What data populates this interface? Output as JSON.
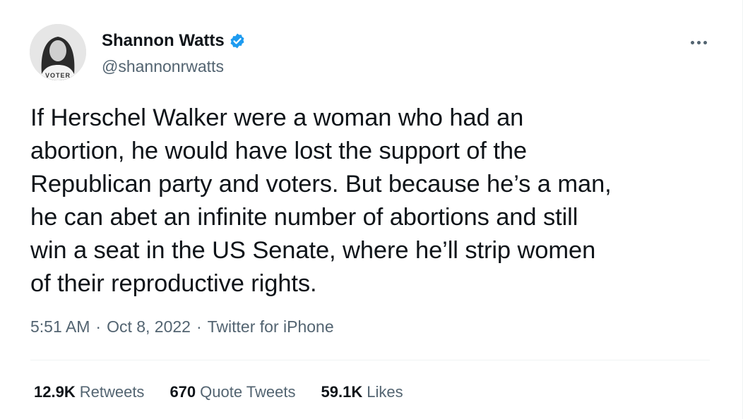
{
  "author": {
    "display_name": "Shannon Watts",
    "handle": "@shannonrwatts",
    "verified": true,
    "avatar_icon": "profile-photo",
    "avatar_shirt_text": "VOTER"
  },
  "tweet": {
    "text": "If Herschel Walker were a woman who had an\nabortion, he would have lost the support of the\nRepublican party and voters. But because he’s a man,\nhe can abet an infinite number of abortions and still\nwin a seat in the US Senate, where he’ll strip women\nof their reproductive rights.",
    "time": "5:51 AM",
    "date": "Oct 8, 2022",
    "source": "Twitter for iPhone",
    "separator": "·"
  },
  "stats": {
    "retweets_count": "12.9K",
    "retweets_label": "Retweets",
    "quotes_count": "670",
    "quotes_label": "Quote Tweets",
    "likes_count": "59.1K",
    "likes_label": "Likes"
  },
  "colors": {
    "text_primary": "#0f1419",
    "text_secondary": "#536471",
    "verified_blue": "#1d9bf0",
    "divider": "#eff3f4"
  }
}
